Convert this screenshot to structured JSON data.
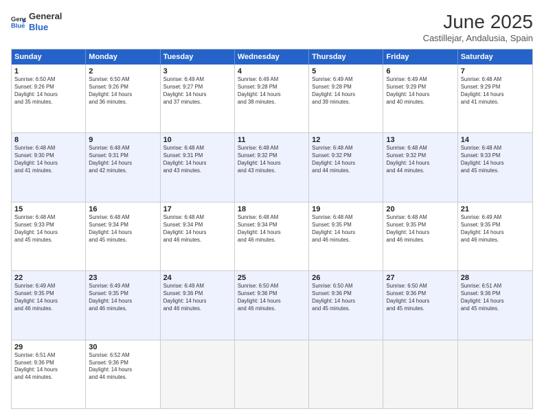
{
  "logo": {
    "line1": "General",
    "line2": "Blue"
  },
  "title": "June 2025",
  "location": "Castillejar, Andalusia, Spain",
  "days_of_week": [
    "Sunday",
    "Monday",
    "Tuesday",
    "Wednesday",
    "Thursday",
    "Friday",
    "Saturday"
  ],
  "rows": [
    [
      {
        "day": "",
        "info": ""
      },
      {
        "day": "2",
        "info": "Sunrise: 6:50 AM\nSunset: 9:26 PM\nDaylight: 14 hours\nand 36 minutes."
      },
      {
        "day": "3",
        "info": "Sunrise: 6:49 AM\nSunset: 9:27 PM\nDaylight: 14 hours\nand 37 minutes."
      },
      {
        "day": "4",
        "info": "Sunrise: 6:49 AM\nSunset: 9:28 PM\nDaylight: 14 hours\nand 38 minutes."
      },
      {
        "day": "5",
        "info": "Sunrise: 6:49 AM\nSunset: 9:28 PM\nDaylight: 14 hours\nand 39 minutes."
      },
      {
        "day": "6",
        "info": "Sunrise: 6:49 AM\nSunset: 9:29 PM\nDaylight: 14 hours\nand 40 minutes."
      },
      {
        "day": "7",
        "info": "Sunrise: 6:48 AM\nSunset: 9:29 PM\nDaylight: 14 hours\nand 41 minutes."
      }
    ],
    [
      {
        "day": "8",
        "info": "Sunrise: 6:48 AM\nSunset: 9:30 PM\nDaylight: 14 hours\nand 41 minutes."
      },
      {
        "day": "9",
        "info": "Sunrise: 6:48 AM\nSunset: 9:31 PM\nDaylight: 14 hours\nand 42 minutes."
      },
      {
        "day": "10",
        "info": "Sunrise: 6:48 AM\nSunset: 9:31 PM\nDaylight: 14 hours\nand 43 minutes."
      },
      {
        "day": "11",
        "info": "Sunrise: 6:48 AM\nSunset: 9:32 PM\nDaylight: 14 hours\nand 43 minutes."
      },
      {
        "day": "12",
        "info": "Sunrise: 6:48 AM\nSunset: 9:32 PM\nDaylight: 14 hours\nand 44 minutes."
      },
      {
        "day": "13",
        "info": "Sunrise: 6:48 AM\nSunset: 9:32 PM\nDaylight: 14 hours\nand 44 minutes."
      },
      {
        "day": "14",
        "info": "Sunrise: 6:48 AM\nSunset: 9:33 PM\nDaylight: 14 hours\nand 45 minutes."
      }
    ],
    [
      {
        "day": "15",
        "info": "Sunrise: 6:48 AM\nSunset: 9:33 PM\nDaylight: 14 hours\nand 45 minutes."
      },
      {
        "day": "16",
        "info": "Sunrise: 6:48 AM\nSunset: 9:34 PM\nDaylight: 14 hours\nand 45 minutes."
      },
      {
        "day": "17",
        "info": "Sunrise: 6:48 AM\nSunset: 9:34 PM\nDaylight: 14 hours\nand 46 minutes."
      },
      {
        "day": "18",
        "info": "Sunrise: 6:48 AM\nSunset: 9:34 PM\nDaylight: 14 hours\nand 46 minutes."
      },
      {
        "day": "19",
        "info": "Sunrise: 6:48 AM\nSunset: 9:35 PM\nDaylight: 14 hours\nand 46 minutes."
      },
      {
        "day": "20",
        "info": "Sunrise: 6:48 AM\nSunset: 9:35 PM\nDaylight: 14 hours\nand 46 minutes."
      },
      {
        "day": "21",
        "info": "Sunrise: 6:49 AM\nSunset: 9:35 PM\nDaylight: 14 hours\nand 46 minutes."
      }
    ],
    [
      {
        "day": "22",
        "info": "Sunrise: 6:49 AM\nSunset: 9:35 PM\nDaylight: 14 hours\nand 46 minutes."
      },
      {
        "day": "23",
        "info": "Sunrise: 6:49 AM\nSunset: 9:35 PM\nDaylight: 14 hours\nand 46 minutes."
      },
      {
        "day": "24",
        "info": "Sunrise: 6:49 AM\nSunset: 9:36 PM\nDaylight: 14 hours\nand 46 minutes."
      },
      {
        "day": "25",
        "info": "Sunrise: 6:50 AM\nSunset: 9:36 PM\nDaylight: 14 hours\nand 46 minutes."
      },
      {
        "day": "26",
        "info": "Sunrise: 6:50 AM\nSunset: 9:36 PM\nDaylight: 14 hours\nand 45 minutes."
      },
      {
        "day": "27",
        "info": "Sunrise: 6:50 AM\nSunset: 9:36 PM\nDaylight: 14 hours\nand 45 minutes."
      },
      {
        "day": "28",
        "info": "Sunrise: 6:51 AM\nSunset: 9:36 PM\nDaylight: 14 hours\nand 45 minutes."
      }
    ],
    [
      {
        "day": "29",
        "info": "Sunrise: 6:51 AM\nSunset: 9:36 PM\nDaylight: 14 hours\nand 44 minutes."
      },
      {
        "day": "30",
        "info": "Sunrise: 6:52 AM\nSunset: 9:36 PM\nDaylight: 14 hours\nand 44 minutes."
      },
      {
        "day": "",
        "info": ""
      },
      {
        "day": "",
        "info": ""
      },
      {
        "day": "",
        "info": ""
      },
      {
        "day": "",
        "info": ""
      },
      {
        "day": "",
        "info": ""
      }
    ]
  ],
  "row0_day1": {
    "day": "1",
    "info": "Sunrise: 6:50 AM\nSunset: 9:26 PM\nDaylight: 14 hours\nand 35 minutes."
  }
}
